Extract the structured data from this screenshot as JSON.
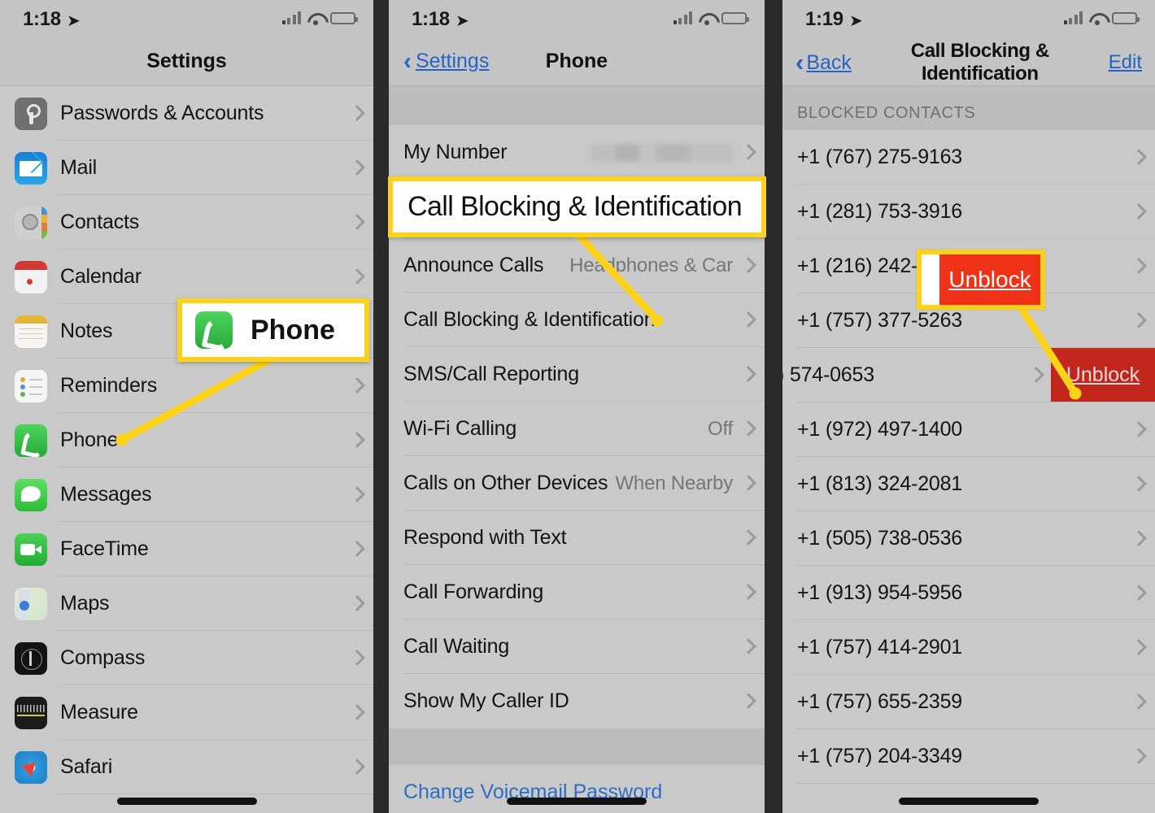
{
  "panels": [
    {
      "status": {
        "time": "1:18",
        "location_icon": "location-arrow-icon",
        "signal_icon": "cellular-bars-icon",
        "wifi_icon": "wifi-icon",
        "battery_icon": "battery-icon"
      },
      "nav": {
        "title": "Settings"
      },
      "items": [
        {
          "label": "Passwords & Accounts",
          "icon": "passwords-icon"
        },
        {
          "label": "Mail",
          "icon": "mail-icon"
        },
        {
          "label": "Contacts",
          "icon": "contacts-icon"
        },
        {
          "label": "Calendar",
          "icon": "calendar-icon"
        },
        {
          "label": "Notes",
          "icon": "notes-icon"
        },
        {
          "label": "Reminders",
          "icon": "reminders-icon"
        },
        {
          "label": "Phone",
          "icon": "phone-icon"
        },
        {
          "label": "Messages",
          "icon": "messages-icon"
        },
        {
          "label": "FaceTime",
          "icon": "facetime-icon"
        },
        {
          "label": "Maps",
          "icon": "maps-icon"
        },
        {
          "label": "Compass",
          "icon": "compass-icon"
        },
        {
          "label": "Measure",
          "icon": "measure-icon"
        },
        {
          "label": "Safari",
          "icon": "safari-icon"
        }
      ]
    },
    {
      "status": {
        "time": "1:18"
      },
      "nav": {
        "back_label": "Settings",
        "title": "Phone"
      },
      "items": [
        {
          "label": "My Number",
          "value": "",
          "redacted": true
        },
        {
          "label": "Call Blocking & Identification",
          "value": ""
        },
        {
          "label": "Announce Calls",
          "value": "Headphones & Car"
        },
        {
          "label": "Call Blocking & Identification",
          "value": ""
        },
        {
          "label": "SMS/Call Reporting",
          "value": ""
        },
        {
          "label": "Wi-Fi Calling",
          "value": "Off"
        },
        {
          "label": "Calls on Other Devices",
          "value": "When Nearby"
        },
        {
          "label": "Respond with Text",
          "value": ""
        },
        {
          "label": "Call Forwarding",
          "value": ""
        },
        {
          "label": "Call Waiting",
          "value": ""
        },
        {
          "label": "Show My Caller ID",
          "value": ""
        }
      ],
      "footer_link": "Change Voicemail Password"
    },
    {
      "status": {
        "time": "1:19"
      },
      "nav": {
        "back_label": "Back",
        "title": "Call Blocking & Identification",
        "edit_label": "Edit"
      },
      "section_header": "BLOCKED CONTACTS",
      "blocked": [
        {
          "number": "+1 (767) 275-9163"
        },
        {
          "number": "+1 (281) 753-3916"
        },
        {
          "number": "+1 (216) 242-1"
        },
        {
          "number": "+1 (757) 377-5263"
        },
        {
          "number": ") 574-0653",
          "swiped": true,
          "action_label": "Unblock"
        },
        {
          "number": "+1 (972) 497-1400"
        },
        {
          "number": "+1 (813) 324-2081"
        },
        {
          "number": "+1 (505) 738-0536"
        },
        {
          "number": "+1 (913) 954-5956"
        },
        {
          "number": "+1 (757) 414-2901"
        },
        {
          "number": "+1 (757) 655-2359"
        },
        {
          "number": "+1 (757) 204-3349"
        }
      ]
    }
  ],
  "callouts": {
    "phone": {
      "label": "Phone",
      "icon": "phone-icon"
    },
    "call_blocking": {
      "label": "Call Blocking & Identification"
    },
    "unblock": {
      "label": "Unblock"
    }
  },
  "colors": {
    "highlight": "#ffd21a",
    "destructive": "#f03218",
    "destructive_dim": "#c1271c",
    "link": "#2563c4",
    "panel_bg": "#c9c9c9",
    "divider_bg": "#2b2b2b"
  }
}
